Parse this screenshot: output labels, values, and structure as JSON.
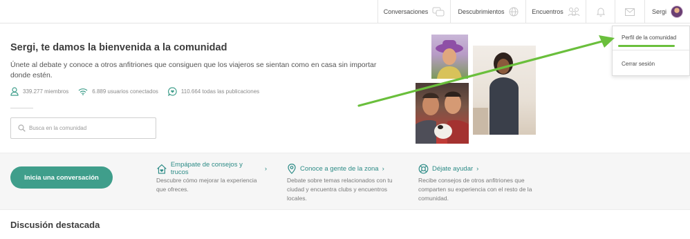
{
  "nav": {
    "conversations": "Conversaciones",
    "discoveries": "Descubrimientos",
    "meetups": "Encuentros",
    "user_name": "Sergi",
    "icons": [
      "chat-bubbles-icon",
      "globe-icon",
      "people-group-icon",
      "bell-icon",
      "mail-icon",
      "avatar"
    ]
  },
  "dropdown": {
    "profile": "Perfil de la comunidad",
    "logout": "Cerrar sesión"
  },
  "hero": {
    "title": "Sergi, te damos la bienvenida a la comunidad",
    "subtitle": "Únete al debate y conoce a otros anfitriones que consiguen que los viajeros se sientan como en casa sin importar donde estén.",
    "stats": {
      "members": "339.277 miembros",
      "online": "6.889 usuarios conectados",
      "posts": "110.664 todas las publicaciones"
    },
    "search_placeholder": "Busca en la comunidad"
  },
  "actions": {
    "cta": "Inicia una conversación",
    "tips": [
      {
        "title": "Empápate de consejos y trucos",
        "desc": "Descubre cómo mejorar la experiencia que ofreces."
      },
      {
        "title": "Conoce a gente de la zona",
        "desc": "Debate sobre temas relacionados con tu ciudad y encuentra clubs y encuentros locales."
      },
      {
        "title": "Déjate ayudar",
        "desc": "Recibe consejos de otros anfitriones que comparten su experiencia con el resto de la comunidad."
      }
    ]
  },
  "featured": {
    "title": "Discusión destacada"
  },
  "colors": {
    "accent_teal": "#3f9e8b",
    "link_teal": "#2c8b86",
    "annotation_green": "#6abf3c"
  }
}
